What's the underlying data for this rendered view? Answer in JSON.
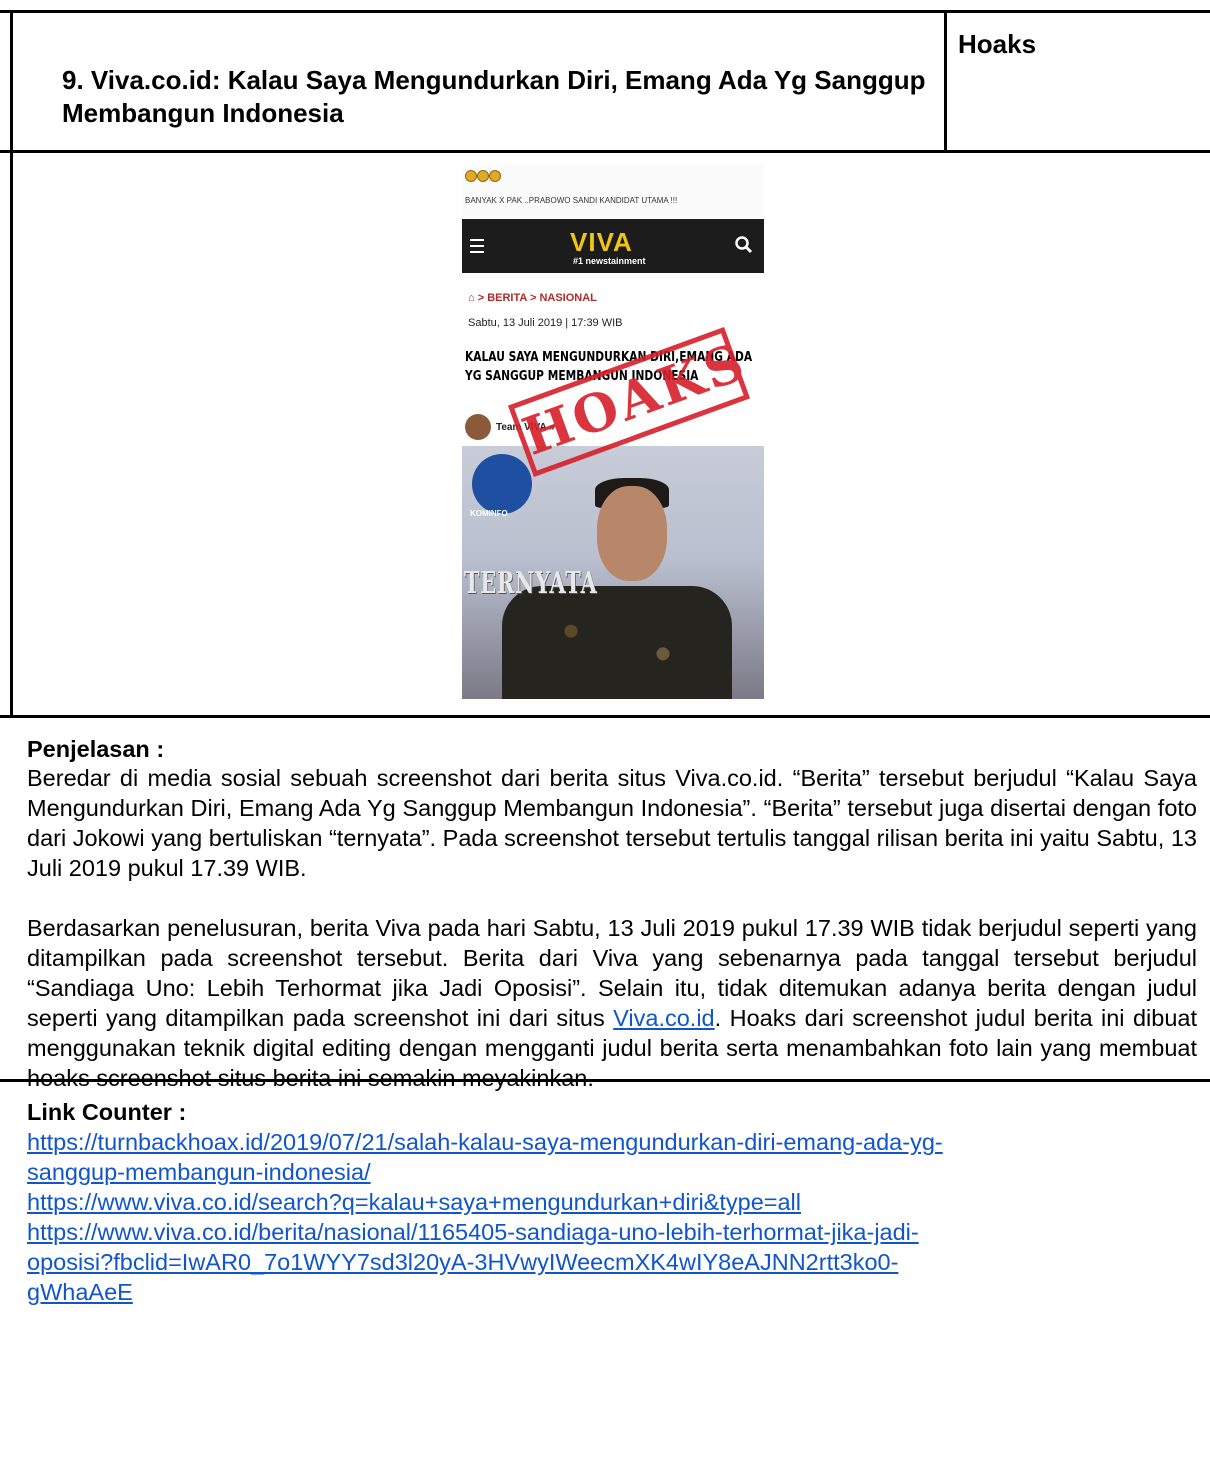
{
  "header": {
    "title": "9. Viva.co.id: Kalau Saya Mengundurkan Diri, Emang Ada Yg Sanggup Membangun Indonesia",
    "status": "Hoaks"
  },
  "screenshot": {
    "caption": "BANYAK X PAK ..PRABOWO SANDI KANDIDAT UTAMA !!!",
    "logo": "VIVA",
    "tagline": "#1 newstainment",
    "breadcrumb": "> BERITA > NASIONAL",
    "date": "Sabtu, 13 Juli 2019 | 17:39 WIB",
    "headline_line1": "KALAU SAYA MENGUNDURKAN DIRI,EMANG ADA",
    "headline_line2": "YG SANGGUP MEMBANGUN INDONESIA",
    "author": "Team VIVA »",
    "photo_overlay": "TERNYATA",
    "stamp": "HOAKS",
    "stamp_color": "#d71f2a",
    "watermark": "KOMINFO"
  },
  "explanation": {
    "heading": "Penjelasan :",
    "p1": "Beredar di media sosial sebuah screenshot dari berita situs Viva.co.id. “Berita” tersebut berjudul “Kalau Saya Mengundurkan Diri, Emang Ada Yg Sanggup Membangun Indonesia”. “Berita” tersebut juga disertai dengan foto dari Jokowi yang bertuliskan “ternyata”. Pada screenshot tersebut tertulis tanggal rilisan berita ini yaitu Sabtu, 13 Juli 2019 pukul 17.39 WIB.",
    "p2_before": "Berdasarkan penelusuran, berita Viva pada hari Sabtu, 13 Juli 2019 pukul 17.39 WIB tidak berjudul seperti yang ditampilkan pada screenshot tersebut. Berita dari Viva yang sebenarnya pada tanggal tersebut berjudul “Sandiaga Uno: Lebih Terhormat jika Jadi Oposisi”. Selain itu, tidak ditemukan adanya berita dengan judul seperti yang ditampilkan pada screenshot ini dari situs ",
    "p2_link": "Viva.co.id",
    "p2_after": ". Hoaks dari screenshot judul berita ini dibuat menggunakan teknik digital editing dengan mengganti judul berita serta menambahkan foto lain yang membuat hoaks screenshot situs berita ini semakin meyakinkan."
  },
  "links": {
    "heading": "Link Counter :",
    "items": [
      {
        "line1": "https://turnbackhoax.id/2019/07/21/salah-kalau-saya-mengundurkan-diri-emang-ada-yg-",
        "line2": "sanggup-membangun-indonesia/"
      },
      {
        "line1": "https://www.viva.co.id/search?q=kalau+saya+mengundurkan+diri&type=all",
        "line2": ""
      },
      {
        "line1": "https://www.viva.co.id/berita/nasional/1165405-sandiaga-uno-lebih-terhormat-jika-jadi-",
        "line2": "oposisi?fbclid=IwAR0_7o1WYY7sd3l20yA-3HVwyIWeecmXK4wIY8eAJNN2rtt3ko0-",
        "line3": "gWhaAeE"
      }
    ],
    "link_color": "#1155cc"
  }
}
